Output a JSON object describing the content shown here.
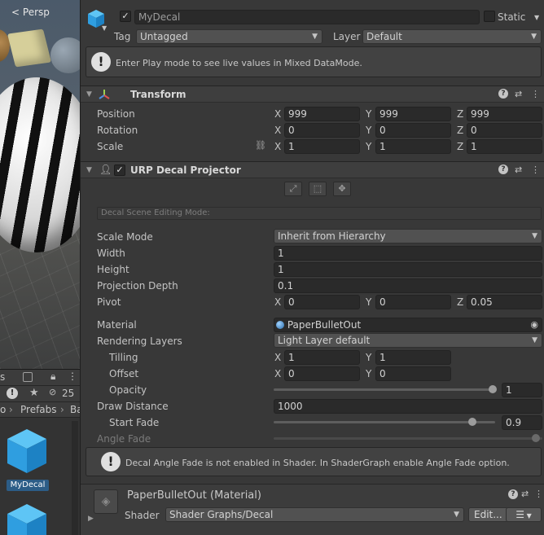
{
  "scene_view": {
    "persp_label": "Persp"
  },
  "project": {
    "toolbar_count": "25",
    "breadcrumb_prefix": "o",
    "breadcrumb_separator": "›",
    "breadcrumb_folder": "Prefabs",
    "breadcrumb_next": "Ba",
    "selected_asset": "MyDecal",
    "toolbar_label_fragment": "s"
  },
  "gameobject": {
    "active": true,
    "name": "MyDecal",
    "static_label": "Static",
    "tag_label": "Tag",
    "tag_value": "Untagged",
    "layer_label": "Layer",
    "layer_value": "Default",
    "info_message": "Enter Play mode to see live values in Mixed DataMode."
  },
  "transform": {
    "title": "Transform",
    "position_label": "Position",
    "rotation_label": "Rotation",
    "scale_label": "Scale",
    "position": {
      "x": "999",
      "y": "999",
      "z": "999"
    },
    "rotation": {
      "x": "0",
      "y": "0",
      "z": "0"
    },
    "scale": {
      "x": "1",
      "y": "1",
      "z": "1"
    }
  },
  "axes": {
    "x": "X",
    "y": "Y",
    "z": "Z"
  },
  "decal": {
    "title": "URP Decal Projector",
    "enabled": true,
    "edit_mode_label": "Decal Scene Editing Mode:",
    "scale_mode_label": "Scale Mode",
    "scale_mode_value": "Inherit from Hierarchy",
    "width_label": "Width",
    "width_value": "1",
    "height_label": "Height",
    "height_value": "1",
    "projection_depth_label": "Projection Depth",
    "projection_depth_value": "0.1",
    "pivot_label": "Pivot",
    "pivot": {
      "x": "0",
      "y": "0",
      "z": "0.05"
    },
    "material_label": "Material",
    "material_value": "PaperBulletOut",
    "rendering_layers_label": "Rendering Layers",
    "rendering_layers_value": "Light Layer default",
    "tilling_label": "Tilling",
    "tilling": {
      "x": "1",
      "y": "1"
    },
    "offset_label": "Offset",
    "offset": {
      "x": "0",
      "y": "0"
    },
    "opacity_label": "Opacity",
    "opacity_value": "1",
    "draw_distance_label": "Draw Distance",
    "draw_distance_value": "1000",
    "start_fade_label": "Start Fade",
    "start_fade_value": "0.9",
    "angle_fade_label": "Angle Fade",
    "angle_fade_warning": "Decal Angle Fade is not enabled in Shader. In ShaderGraph enable Angle Fade option."
  },
  "material_section": {
    "title": "PaperBulletOut (Material)",
    "shader_label": "Shader",
    "shader_value": "Shader Graphs/Decal",
    "edit_button": "Edit..."
  }
}
